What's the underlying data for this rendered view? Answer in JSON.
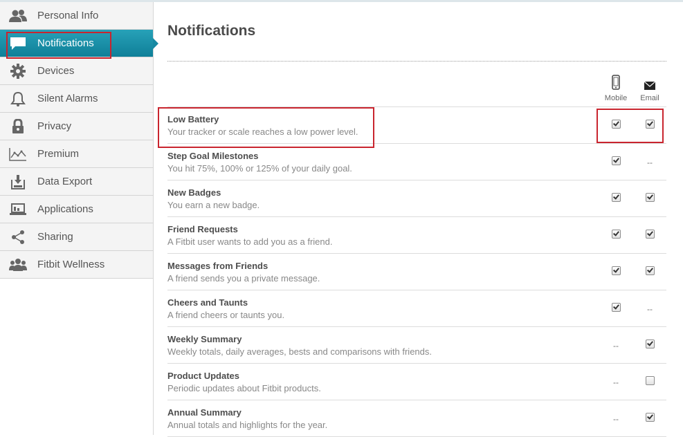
{
  "sidebar": {
    "items": [
      {
        "label": "Personal Info",
        "icon": "user-icon",
        "active": false
      },
      {
        "label": "Notifications",
        "icon": "speech-bubble-icon",
        "active": true
      },
      {
        "label": "Devices",
        "icon": "gear-icon",
        "active": false
      },
      {
        "label": "Silent Alarms",
        "icon": "bell-icon",
        "active": false
      },
      {
        "label": "Privacy",
        "icon": "lock-icon",
        "active": false
      },
      {
        "label": "Premium",
        "icon": "chart-icon",
        "active": false
      },
      {
        "label": "Data Export",
        "icon": "export-icon",
        "active": false
      },
      {
        "label": "Applications",
        "icon": "laptop-icon",
        "active": false
      },
      {
        "label": "Sharing",
        "icon": "share-icon",
        "active": false
      },
      {
        "label": "Fitbit Wellness",
        "icon": "group-icon",
        "active": false
      }
    ]
  },
  "main": {
    "title": "Notifications",
    "columns": {
      "mobile": "Mobile",
      "email": "Email"
    },
    "rows": [
      {
        "title": "Low Battery",
        "desc": "Your tracker or scale reaches a low power level.",
        "mobile": "checked",
        "email": "checked"
      },
      {
        "title": "Step Goal Milestones",
        "desc": "You hit 75%, 100% or 125% of your daily goal.",
        "mobile": "checked",
        "email": "--"
      },
      {
        "title": "New Badges",
        "desc": "You earn a new badge.",
        "mobile": "checked",
        "email": "checked"
      },
      {
        "title": "Friend Requests",
        "desc": "A Fitbit user wants to add you as a friend.",
        "mobile": "checked",
        "email": "checked"
      },
      {
        "title": "Messages from Friends",
        "desc": "A friend sends you a private message.",
        "mobile": "checked",
        "email": "checked"
      },
      {
        "title": "Cheers and Taunts",
        "desc": "A friend cheers or taunts you.",
        "mobile": "checked",
        "email": "--"
      },
      {
        "title": "Weekly Summary",
        "desc": "Weekly totals, daily averages, bests and comparisons with friends.",
        "mobile": "--",
        "email": "checked"
      },
      {
        "title": "Product Updates",
        "desc": "Periodic updates about Fitbit products.",
        "mobile": "--",
        "email": "unchecked"
      },
      {
        "title": "Annual Summary",
        "desc": "Annual totals and highlights for the year.",
        "mobile": "--",
        "email": "checked"
      }
    ]
  },
  "colors": {
    "accent": "#1a8fa8",
    "highlight": "#c9242e"
  }
}
